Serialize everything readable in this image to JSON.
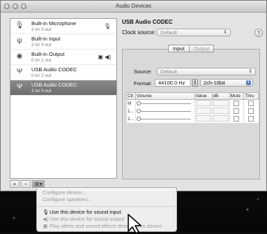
{
  "window": {
    "title": "Audio Devices"
  },
  "devices": [
    {
      "name": "Built-in Microphone",
      "sub": "2 in/ 0 out",
      "icon": "microphone-icon",
      "right": "🎙"
    },
    {
      "name": "Built-in Input",
      "sub": "2 in/ 0 out",
      "icon": "input-jack-icon",
      "right": ""
    },
    {
      "name": "Built-in Output",
      "sub": "0 in/ 2 out",
      "icon": "speaker-icon",
      "right": "▣ ◀)"
    },
    {
      "name": "USB Audio CODEC",
      "sub": "0 in/ 2 out",
      "icon": "usb-icon",
      "right": ""
    },
    {
      "name": "USB Audio CODEC",
      "sub": "2 in/ 0 out",
      "icon": "usb-icon",
      "right": "",
      "selected": true
    }
  ],
  "list_buttons": {
    "add": "+",
    "remove": "−",
    "gear": "⚙▾"
  },
  "detail": {
    "device_title": "USB Audio CODEC",
    "clock_label": "Clock source:",
    "clock_value": "Default",
    "tabs": [
      "Input",
      "Output"
    ],
    "active_tab": "Input",
    "source_label": "Source:",
    "source_value": "Default",
    "format_label": "Format:",
    "format_rate": "44100.0 Hz",
    "format_bits": "2ch-16bit"
  },
  "channel_table": {
    "headers": [
      "Ch",
      "Volume",
      "Value",
      "dB",
      "Mute",
      "Thru"
    ],
    "rows": [
      {
        "ch": "M"
      },
      {
        "ch": "1..."
      },
      {
        "ch": "2..."
      }
    ]
  },
  "gear_menu": {
    "items": [
      {
        "label": "Configure device...",
        "enabled": false,
        "icon": ""
      },
      {
        "label": "Configure speakers...",
        "enabled": false,
        "icon": ""
      },
      {
        "label": "Use this device for sound input",
        "enabled": true,
        "icon": "microphone-icon"
      },
      {
        "label": "Use this device for sound output",
        "enabled": false,
        "icon": "speaker-icon"
      },
      {
        "label": "Play alerts and sound effects through this device",
        "enabled": false,
        "icon": "alert-icon"
      }
    ]
  }
}
